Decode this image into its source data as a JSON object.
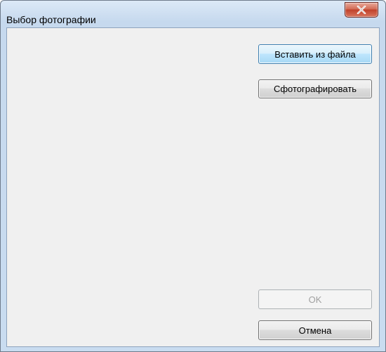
{
  "window": {
    "title": "Выбор фотографии"
  },
  "buttons": {
    "insert_from_file": "Вставить из файла",
    "take_photo": "Сфотографировать",
    "ok": "OK",
    "cancel": "Отмена"
  },
  "icons": {
    "close": "close-icon"
  },
  "colors": {
    "titlebar": "#c9dcf0",
    "client_bg": "#f0f0f0",
    "close_button": "#c0412a",
    "focus_border": "#3c7fb1"
  }
}
